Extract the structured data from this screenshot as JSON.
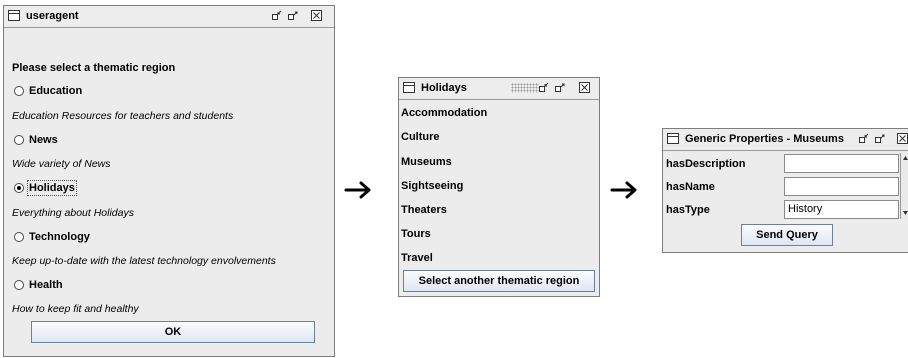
{
  "useragent": {
    "title": "useragent",
    "prompt": "Please select a thematic region",
    "options": [
      {
        "label": "Education",
        "description": "Education Resources for teachers and students",
        "selected": false
      },
      {
        "label": "News",
        "description": "Wide variety of News",
        "selected": false
      },
      {
        "label": "Holidays",
        "description": "Everything about Holidays",
        "selected": true
      },
      {
        "label": "Technology",
        "description": "Keep up-to-date with the latest technology envolvements",
        "selected": false
      },
      {
        "label": "Health",
        "description": "How to keep fit and healthy",
        "selected": false
      }
    ],
    "ok_label": "OK"
  },
  "holidays": {
    "title": "Holidays",
    "items": [
      "Accommodation",
      "Culture",
      "Museums",
      "Sightseeing",
      "Theaters",
      "Tours",
      "Travel"
    ],
    "select_another_label": "Select another thematic region"
  },
  "properties": {
    "title": "Generic Properties - Museums",
    "fields": [
      {
        "label": "hasDescription",
        "value": ""
      },
      {
        "label": "hasName",
        "value": ""
      },
      {
        "label": "hasType",
        "value": "History"
      }
    ],
    "send_label": "Send Query"
  },
  "icons": {
    "window": "window-icon",
    "minimize": "minimize-icon",
    "maximize": "maximize-icon",
    "close": "close-icon",
    "flow_arrow": "right-arrow-icon"
  },
  "colors": {
    "window_bg": "#ececec",
    "button_border": "#6d7f99",
    "arrow": "#000000"
  }
}
